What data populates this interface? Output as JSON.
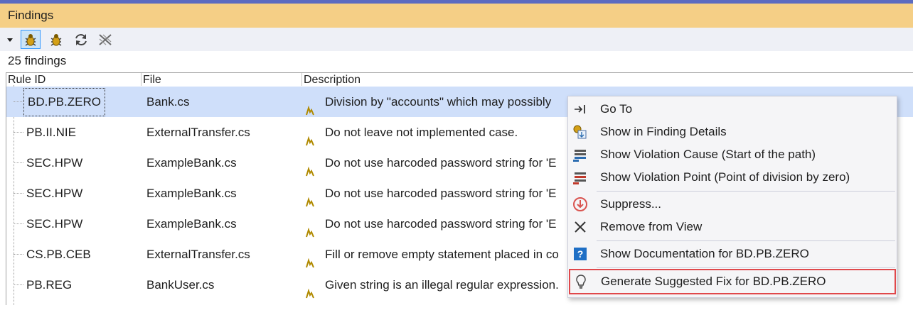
{
  "window": {
    "title": "Findings"
  },
  "toolbar": {
    "buttons": [
      {
        "name": "dropdown-icon"
      },
      {
        "name": "bug-filter-icon",
        "selected": true
      },
      {
        "name": "bug-icon"
      },
      {
        "name": "refresh-icon"
      },
      {
        "name": "clear-icon"
      }
    ]
  },
  "summary": {
    "count_text": "25 findings"
  },
  "columns": {
    "rule_id": "Rule ID",
    "file": "File",
    "description": "Description"
  },
  "rows": [
    {
      "rule_id": "BD.PB.ZERO",
      "file": "Bank.cs",
      "description": "Division by \"accounts\" which may possibly",
      "selected": true
    },
    {
      "rule_id": "PB.II.NIE",
      "file": "ExternalTransfer.cs",
      "description": "Do not leave not implemented case."
    },
    {
      "rule_id": "SEC.HPW",
      "file": "ExampleBank.cs",
      "description": "Do not use harcoded password string for 'E"
    },
    {
      "rule_id": "SEC.HPW",
      "file": "ExampleBank.cs",
      "description": "Do not use harcoded password string for 'E"
    },
    {
      "rule_id": "SEC.HPW",
      "file": "ExampleBank.cs",
      "description": "Do not use harcoded password string for 'E"
    },
    {
      "rule_id": "CS.PB.CEB",
      "file": "ExternalTransfer.cs",
      "description": "Fill or remove empty statement placed in co"
    },
    {
      "rule_id": "PB.REG",
      "file": "BankUser.cs",
      "description": "Given string is an illegal regular expression."
    }
  ],
  "context_menu": {
    "items": [
      {
        "label": "Go To",
        "icon": "go-to-icon"
      },
      {
        "label": "Show in Finding Details",
        "icon": "finding-details-icon"
      },
      {
        "label": "Show Violation Cause (Start of the path)",
        "icon": "violation-cause-icon"
      },
      {
        "label": "Show Violation Point (Point of division by zero)",
        "icon": "violation-point-icon"
      },
      {
        "label": "Suppress...",
        "icon": "suppress-icon"
      },
      {
        "label": "Remove from View",
        "icon": "remove-icon"
      },
      {
        "label": "Show Documentation for BD.PB.ZERO",
        "icon": "help-icon"
      },
      {
        "label": "Generate Suggested Fix for BD.PB.ZERO",
        "icon": "lightbulb-icon",
        "highlighted": true
      }
    ]
  },
  "colors": {
    "title_bar": "#f5cf86",
    "selection": "#cfdffa",
    "highlight_border": "#e0484b"
  }
}
